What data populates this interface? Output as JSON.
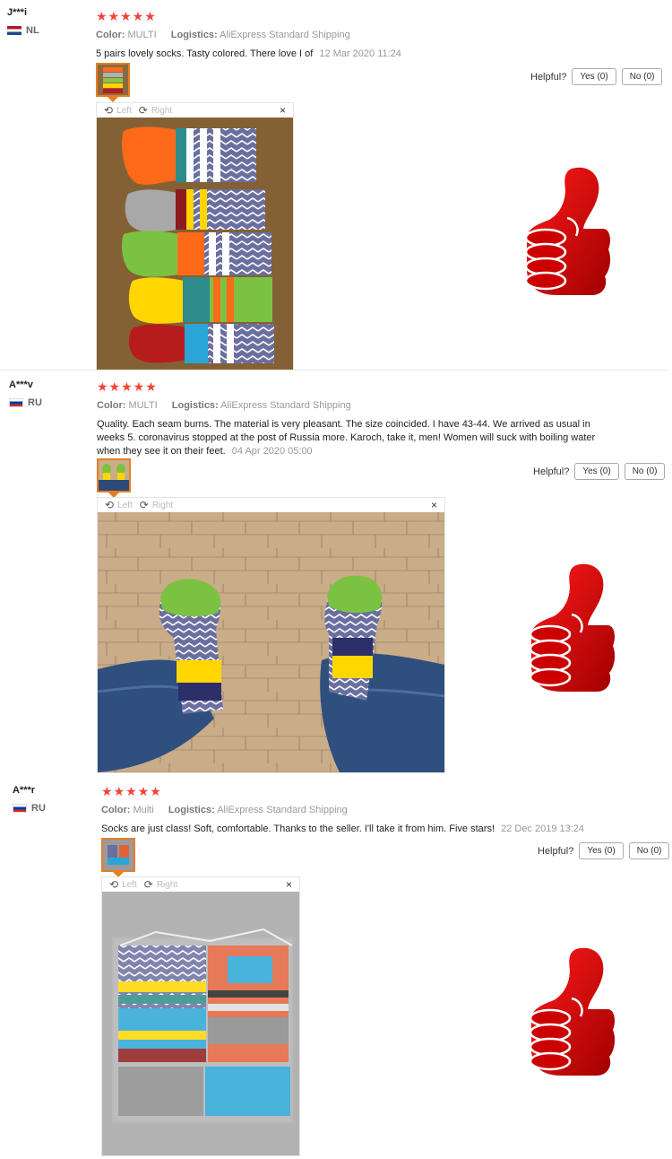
{
  "helpful_label": "Helpful?",
  "viewer": {
    "left_label": "Left",
    "right_label": "Right",
    "close_glyph": "×",
    "rotate_left_glyph": "⟲",
    "rotate_right_glyph": "⟳"
  },
  "reviews": [
    {
      "user": "J***i",
      "country": "NL",
      "stars": "★★★★★",
      "color_label": "Color:",
      "color_value": "MULTI",
      "logistics_label": "Logistics:",
      "logistics_value": "AliExpress Standard Shipping",
      "text": "5 pairs lovely socks. Tasty colored. There love I of",
      "date": "12 Mar 2020 11:24",
      "yes_label": "Yes (0)",
      "no_label": "No (0)"
    },
    {
      "user": "A***v",
      "country": "RU",
      "stars": "★★★★★",
      "color_label": "Color:",
      "color_value": "MULTI",
      "logistics_label": "Logistics:",
      "logistics_value": "AliExpress Standard Shipping",
      "text": "Quality. Each seam burns. The material is very pleasant. The size coincided. I have 43-44. We arrived as usual in weeks 5. coronavirus stopped at the post of Russia more. Karoch, take it, men! Women will suck with boiling water when they see it on their feet.",
      "date": "04 Apr 2020 05:00",
      "yes_label": "Yes (0)",
      "no_label": "No (0)"
    },
    {
      "user": "A***r",
      "country": "RU",
      "stars": "★★★★★",
      "color_label": "Color:",
      "color_value": "Multi",
      "logistics_label": "Logistics:",
      "logistics_value": "AliExpress Standard Shipping",
      "text": "Socks are just class! Soft, comfortable. Thanks to the seller. I'll take it from him. Five stars!",
      "date": "22 Dec 2019 13:24",
      "yes_label": "Yes (0)",
      "no_label": "No (0)"
    }
  ]
}
